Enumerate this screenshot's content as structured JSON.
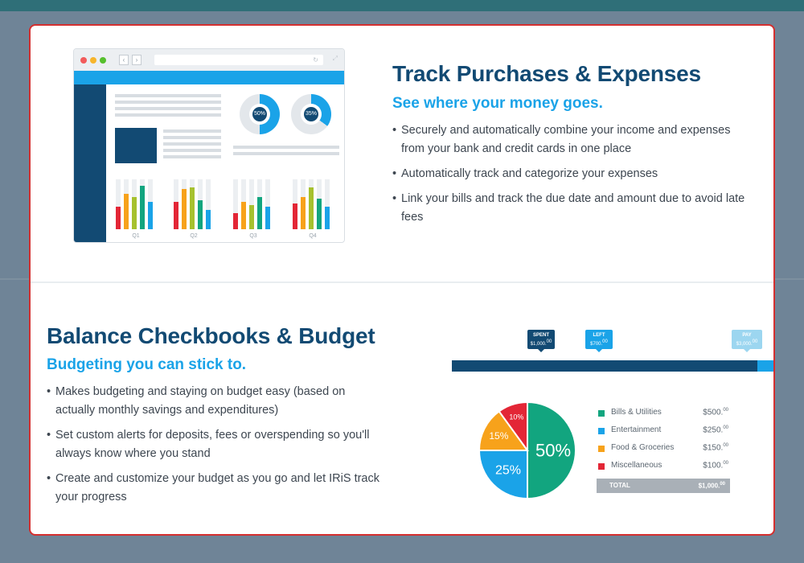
{
  "section_purchases": {
    "title": "Track Purchases & Expenses",
    "subtitle": "See where your money goes.",
    "bullets": [
      "Securely and automatically combine your income and expenses from your bank and credit cards in one place",
      "Automatically track and categorize your expenses",
      "Link your bills and track the due date and amount due to avoid late fees"
    ],
    "mockup": {
      "donuts": [
        {
          "label": "50%",
          "fraction": 0.5
        },
        {
          "label": "35%",
          "fraction": 0.35
        }
      ],
      "quarters": [
        "Q1",
        "Q2",
        "Q3",
        "Q4"
      ],
      "bar_colors": [
        "#e32636",
        "#f7a21b",
        "#a6c12e",
        "#12a57f",
        "#1aa3e8"
      ]
    }
  },
  "section_budget": {
    "title": "Balance Checkbooks & Budget",
    "subtitle": "Budgeting you can stick to.",
    "bullets": [
      "Makes budgeting and staying on budget easy (based on actually monthly savings and expenditures)",
      "Set custom alerts for deposits, fees or overspending so you'll always know where you stand",
      "Create and customize your budget as you go and let IRiS track your progress"
    ],
    "progress": {
      "spent": {
        "label": "SPENT",
        "amount": "$1,000.",
        "cents": "00",
        "value": 1000,
        "color": "#124a73"
      },
      "left": {
        "label": "LEFT",
        "amount": "$700.",
        "cents": "00",
        "value": 700,
        "color": "#1aa3e8"
      },
      "pay": {
        "label": "PAY",
        "amount": "$3,000.",
        "cents": "00",
        "value": 3000,
        "color": "#9cd6f0"
      }
    },
    "pie": [
      {
        "label": "Bills & Utilities",
        "amount": "$500.",
        "cents": "00",
        "percent": 50,
        "color": "#12a57f"
      },
      {
        "label": "Entertainment",
        "amount": "$250.",
        "cents": "00",
        "percent": 25,
        "color": "#1aa3e8"
      },
      {
        "label": "Food & Groceries",
        "amount": "$150.",
        "cents": "00",
        "percent": 15,
        "color": "#f7a21b"
      },
      {
        "label": "Miscellaneous",
        "amount": "$100.",
        "cents": "00",
        "percent": 10,
        "color": "#e32636"
      }
    ],
    "total": {
      "label": "TOTAL",
      "amount": "$1,000.",
      "cents": "00"
    }
  },
  "colors": {
    "navy": "#124a73",
    "accent_blue": "#1aa3e8",
    "card_border": "#d42f2f",
    "page_bg": "#6f8497"
  }
}
